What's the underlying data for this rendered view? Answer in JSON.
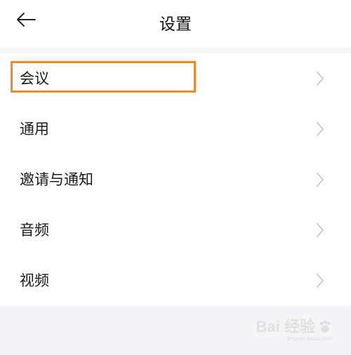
{
  "header": {
    "title": "设置",
    "back_icon": "back-arrow-icon"
  },
  "settings": {
    "items": [
      {
        "label": "会议",
        "highlighted": true
      },
      {
        "label": "通用",
        "highlighted": false
      },
      {
        "label": "邀请与通知",
        "highlighted": false
      },
      {
        "label": "音频",
        "highlighted": false
      },
      {
        "label": "视频",
        "highlighted": false
      }
    ],
    "chevron_icon": "chevron-right-icon"
  },
  "watermark": {
    "brand": "Bai  经验",
    "url": "jingyan.baidu.com"
  },
  "colors": {
    "highlight": "#f08a2a",
    "background": "#ffffff",
    "band": "#f5f5f7",
    "chevron": "#c2c2c2"
  }
}
